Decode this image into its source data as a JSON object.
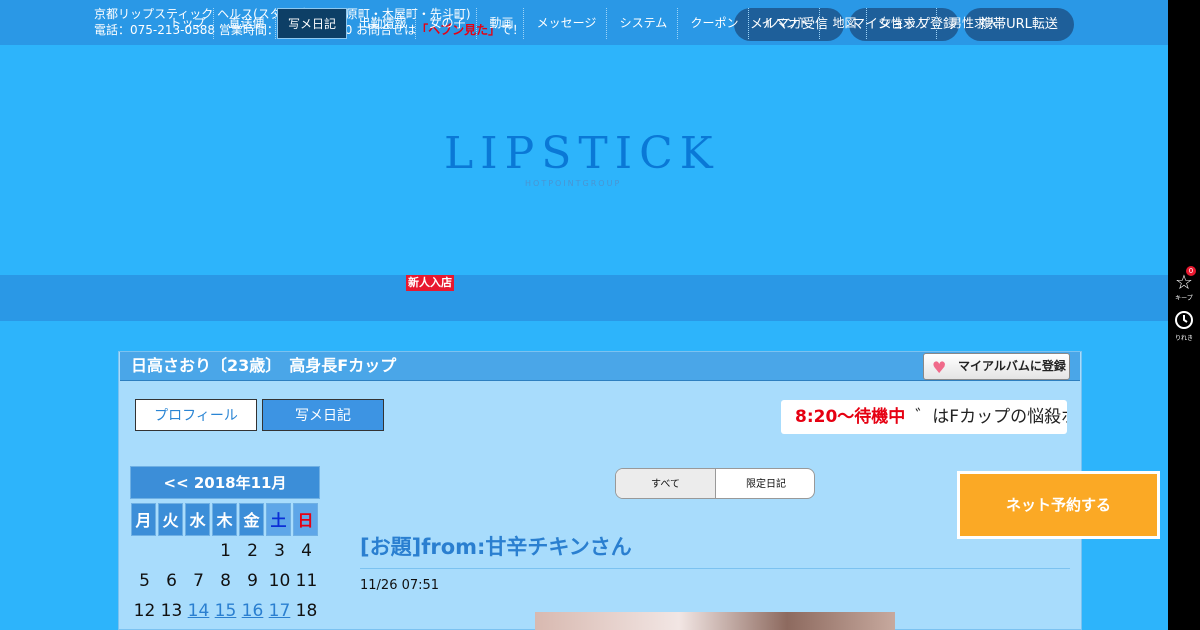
{
  "header": {
    "line1": "京都リップスティック ヘルス(スタンダード/河原町・木屋町・先斗町)",
    "line2_prefix": "電話：075-213-0588 営業時間：6:00～24:00 お問合せは",
    "line2_highlight": "「ヘブン見た」",
    "line2_suffix": "で！",
    "buttons": [
      "メルマガ受信",
      "マイショップ登録",
      "携帯URL転送"
    ]
  },
  "logo": {
    "main": "LIPSTICK",
    "sub": "HOTPOINTGROUP"
  },
  "nav": {
    "items": [
      "トップ",
      "直送便",
      "写メ日記",
      "出勤情報",
      "女の子",
      "動画",
      "メッセージ",
      "システム",
      "クーポン",
      "イベント",
      "地図",
      "女性求人",
      "男性求人"
    ],
    "active_index": 2,
    "new_badge": "新人入店"
  },
  "sidebar": {
    "keep_label": "キープ",
    "history_label": "りれき",
    "keep_count": "0"
  },
  "profile": {
    "title": "日高さおり〔23歳〕　高身長Fカップ",
    "album_button": "マイアルバムに登録",
    "tabs": [
      "プロフィール",
      "写メ日記"
    ],
    "status": "8:20～待機中",
    "tagline": "゛はFカップの悩殺ボ"
  },
  "calendar": {
    "header": "<< 2018年11月",
    "weekdays": [
      "月",
      "火",
      "水",
      "木",
      "金",
      "土",
      "日"
    ],
    "weeks": [
      [
        "",
        "",
        "",
        "1",
        "2",
        "3",
        "4"
      ],
      [
        "5",
        "6",
        "7",
        "8",
        "9",
        "10",
        "11"
      ],
      [
        "12",
        "13",
        "14",
        "15",
        "16",
        "17",
        "18"
      ]
    ],
    "linked_days": [
      "14",
      "15",
      "16",
      "17"
    ]
  },
  "diary": {
    "filters": [
      "すべて",
      "限定日記"
    ],
    "title": "[お題]from:甘辛チキンさん",
    "date": "11/26 07:51"
  },
  "reserve_button": "ネット予約する",
  "colors": {
    "accent": "#2a98e6",
    "status_red": "#e60012",
    "reserve": "#fba925"
  }
}
